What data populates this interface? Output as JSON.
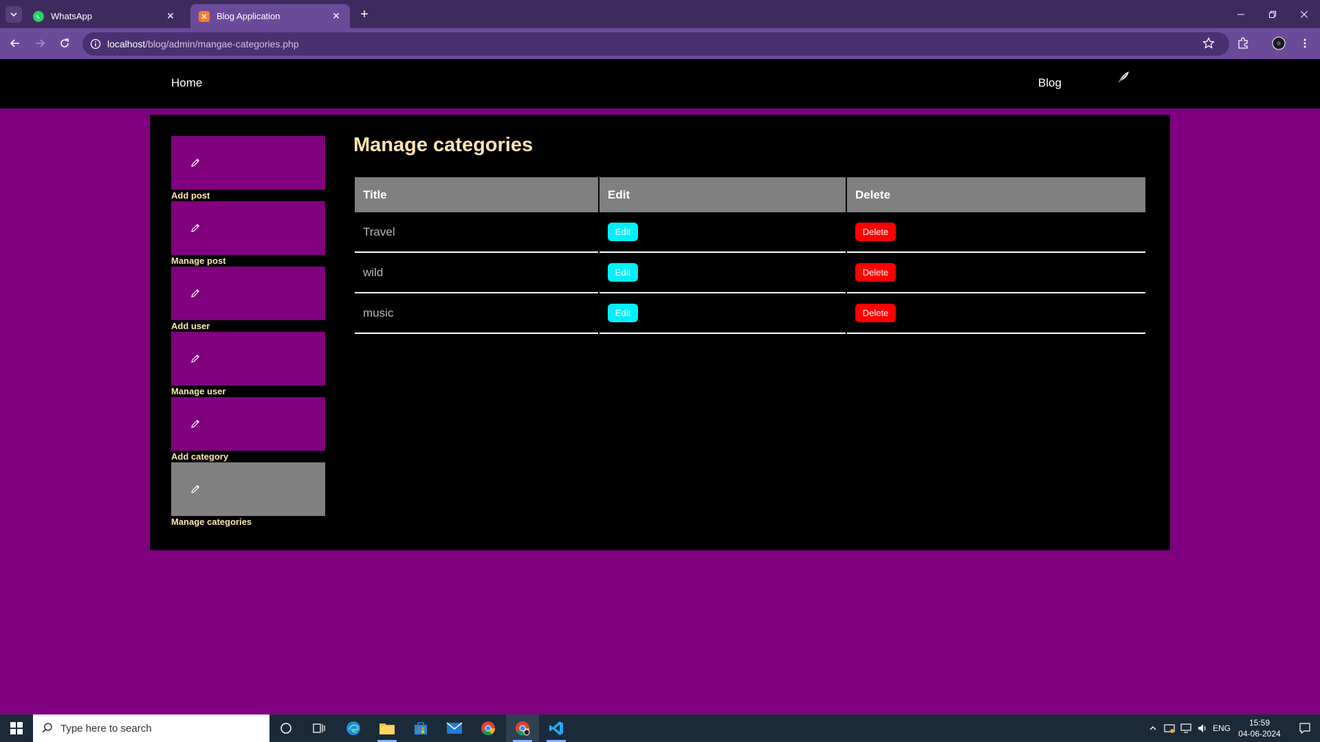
{
  "browser": {
    "tabs": [
      {
        "title": "WhatsApp",
        "icon": "whatsapp-icon",
        "active": false
      },
      {
        "title": "Blog Application",
        "icon": "xampp-icon",
        "active": true
      }
    ],
    "url_host": "localhost",
    "url_path": "/blog/admin/mangae-categories.php"
  },
  "nav": {
    "home": "Home",
    "blog": "Blog"
  },
  "sidebar": {
    "items": [
      {
        "label": "Add post",
        "icon": "pencil-icon",
        "active": false
      },
      {
        "label": "Manage post",
        "icon": "pencil-icon",
        "active": false
      },
      {
        "label": "Add user",
        "icon": "pencil-icon",
        "active": false
      },
      {
        "label": "Manage user",
        "icon": "pencil-icon",
        "active": false
      },
      {
        "label": "Add category",
        "icon": "pencil-icon",
        "active": false
      },
      {
        "label": "Manage categories",
        "icon": "pencil-icon",
        "active": true
      }
    ]
  },
  "main": {
    "title": "Manage categories",
    "columns": [
      "Title",
      "Edit",
      "Delete"
    ],
    "rows": [
      {
        "title": "Travel",
        "edit": "Edit",
        "delete": "Delete"
      },
      {
        "title": "wild",
        "edit": "Edit",
        "delete": "Delete"
      },
      {
        "title": "music",
        "edit": "Edit",
        "delete": "Delete"
      }
    ]
  },
  "taskbar": {
    "search_placeholder": "Type here to search",
    "language": "ENG",
    "time": "15:59",
    "date": "04-06-2024"
  },
  "colors": {
    "page_bg": "#800080",
    "sidebar_item": "#800080",
    "sidebar_active": "#808080",
    "title_color": "#ffe4b5",
    "edit_button": "#00f0ff",
    "delete_button": "#ff0000",
    "table_header": "#808080"
  }
}
